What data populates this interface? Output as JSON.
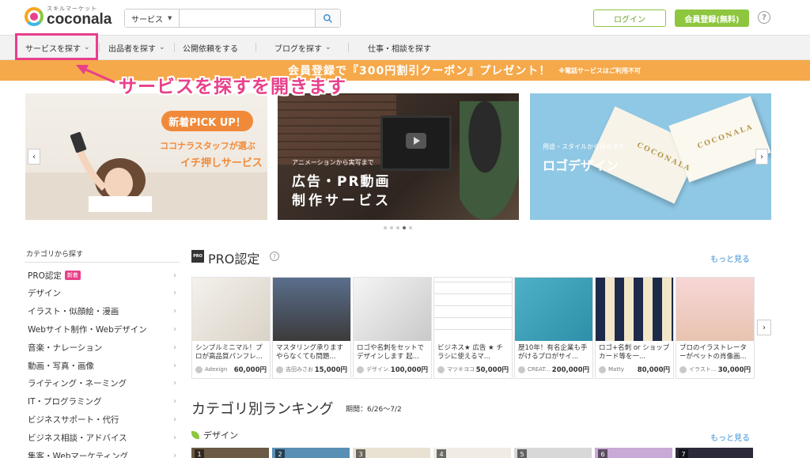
{
  "header": {
    "logo_sub": "スキルマーケット",
    "logo_name": "coconala",
    "search": {
      "category": "サービス",
      "placeholder": ""
    },
    "login": "ログイン",
    "register": "会員登録(無料)",
    "help": "?"
  },
  "nav": {
    "items": [
      {
        "label": "サービスを探す",
        "chev": "⌄"
      },
      {
        "label": "出品者を探す",
        "chev": "⌄"
      },
      {
        "label": "公開依頼をする",
        "chev": ""
      },
      {
        "label": "ブログを探す",
        "chev": "⌄"
      },
      {
        "label": "仕事・相談を探す",
        "chev": ""
      }
    ]
  },
  "banner": {
    "text": "会員登録で『300円割引クーポン』プレゼント！",
    "note": "※電話サービスはご利用不可"
  },
  "annotation": "サービスを探すを開きます",
  "carousel": {
    "slides": [
      {
        "pill": "新着PICK UP！",
        "line1": "ココナラスタッフが選ぶ",
        "line2": "イチ押しサービス"
      },
      {
        "small": "アニメーションから実写まで",
        "big1": "広告・PR動画",
        "big2": "制作サービス"
      },
      {
        "small": "用途・スタイルから探せます",
        "big": "ロゴデザイン",
        "brand": "COCONALA"
      }
    ],
    "dots": 5,
    "active_dot": 3
  },
  "sidebar": {
    "heading": "カテゴリから探す",
    "items": [
      {
        "label": "PRO認定",
        "badge": "新着"
      },
      {
        "label": "デザイン"
      },
      {
        "label": "イラスト・似顔絵・漫画"
      },
      {
        "label": "Webサイト制作・Webデザイン"
      },
      {
        "label": "音楽・ナレーション"
      },
      {
        "label": "動画・写真・画像"
      },
      {
        "label": "ライティング・ネーミング"
      },
      {
        "label": "IT・プログラミング"
      },
      {
        "label": "ビジネスサポート・代行"
      },
      {
        "label": "ビジネス相談・アドバイス"
      },
      {
        "label": "集客・Webマーケティング"
      }
    ]
  },
  "pro": {
    "badge": "PRO",
    "title": "PRO認定",
    "more": "もっと見る",
    "cards": [
      {
        "title": "シンプルミニマル！プロが高品質パンフレ...",
        "seller": "Adexign",
        "price": "60,000円"
      },
      {
        "title": "マスタリング承りますやらなくても問題...",
        "seller": "吉田みさお",
        "price": "15,000円"
      },
      {
        "title": "ロゴや名刺をセットでデザインします 起...",
        "seller": "デザイン...",
        "price": "100,000円"
      },
      {
        "title": "ビジネス★ 広告 ★ チラシに使えるマ...",
        "seller": "マツキヨコ",
        "price": "50,000円"
      },
      {
        "title": "歴10年！有名企業も手がけるプロがサイ...",
        "seller": "CREAT...",
        "price": "200,000円"
      },
      {
        "title": "ロゴ+名刺 or ショップカード等を一...",
        "seller": "Matty",
        "price": "80,000円"
      },
      {
        "title": "プロのイラストレーターがペットの肖像画...",
        "seller": "イラスト...",
        "price": "30,000円"
      }
    ]
  },
  "ranking": {
    "title": "カテゴリ別ランキング",
    "period": "期間：6/26〜7/2",
    "category": "デザイン",
    "more": "もっと見る",
    "ranks": [
      "1",
      "2",
      "3",
      "4",
      "5",
      "6",
      "7"
    ]
  },
  "colors": {
    "accent_green": "#8ec63f",
    "banner_orange": "#f5a94a",
    "highlight_pink": "#e83e8c",
    "link_blue": "#3a8fd6"
  }
}
